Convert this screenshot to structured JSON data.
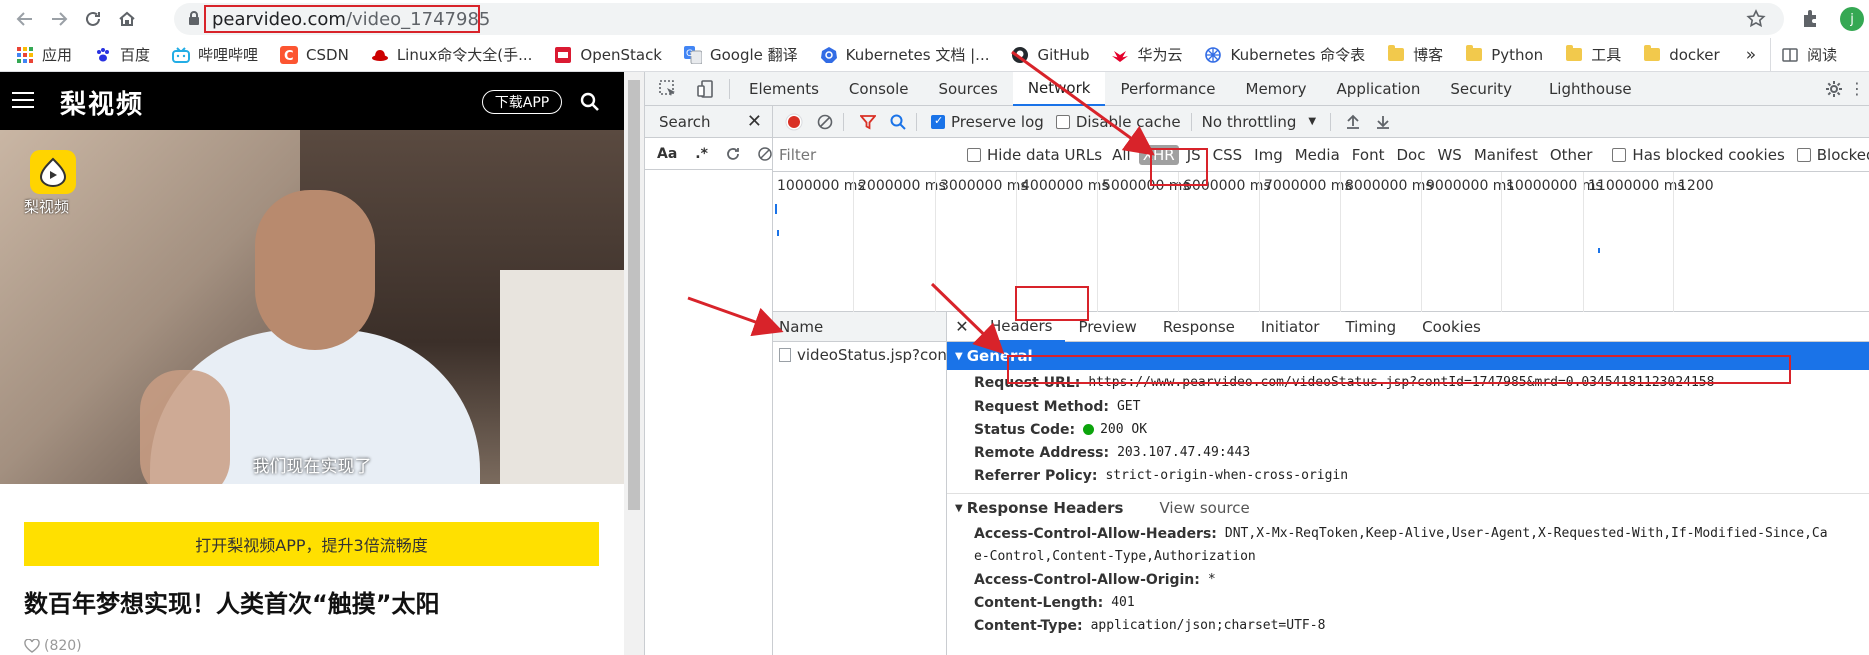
{
  "browser": {
    "url_domain": "pearvideo.com",
    "url_path": "/video_1747985",
    "avatar_letter": "j"
  },
  "bookmarks": [
    {
      "label": "应用",
      "icon": "apps-grid-icon"
    },
    {
      "label": "百度",
      "icon": "baidu-paw-icon"
    },
    {
      "label": "哔哩哔哩",
      "icon": "bilibili-tv-icon"
    },
    {
      "label": "CSDN",
      "icon": "csdn-c-icon"
    },
    {
      "label": "Linux命令大全(手...",
      "icon": "redhat-icon"
    },
    {
      "label": "OpenStack",
      "icon": "openstack-icon"
    },
    {
      "label": "Google 翻译",
      "icon": "google-translate-icon"
    },
    {
      "label": "Kubernetes 文档 |...",
      "icon": "kubernetes-icon"
    },
    {
      "label": "GitHub",
      "icon": "github-icon"
    },
    {
      "label": "华为云",
      "icon": "huawei-icon"
    },
    {
      "label": "Kubernetes 命令表",
      "icon": "kubernetes-icon"
    },
    {
      "label": "博客",
      "icon": "folder-icon"
    },
    {
      "label": "Python",
      "icon": "folder-icon"
    },
    {
      "label": "工具",
      "icon": "folder-icon"
    },
    {
      "label": "docker",
      "icon": "folder-icon"
    }
  ],
  "bookmarks_more": "»",
  "reading_list": "阅读",
  "page": {
    "logo": "梨视频",
    "download_button": "下载APP",
    "video_logo_text": "梨视频",
    "subtitle": "我们现在实现了",
    "open_app_bar": "打开梨视频APP，提升3倍流畅度",
    "headline": "数百年梦想实现！人类首次“触摸”太阳",
    "likes": "(820)"
  },
  "devtools": {
    "tabs": [
      "Elements",
      "Console",
      "Sources",
      "Network",
      "Performance",
      "Memory",
      "Application",
      "Security",
      "Lighthouse"
    ],
    "active_tab": "Network",
    "search_label": "Search",
    "search_tools": [
      "Aa",
      ".*"
    ],
    "preserve_log": "Preserve log",
    "disable_cache": "Disable cache",
    "throttling": "No throttling",
    "filter_placeholder": "Filter",
    "hide_data_urls": "Hide data URLs",
    "filter_types": [
      "All",
      "XHR",
      "JS",
      "CSS",
      "Img",
      "Media",
      "Font",
      "Doc",
      "WS",
      "Manifest",
      "Other"
    ],
    "active_filter": "XHR",
    "has_blocked_cookies": "Has blocked cookies",
    "blocked_requests": "Blocked Re",
    "timeline_ticks": [
      "1000000 ms",
      "2000000 ms",
      "3000000 ms",
      "4000000 ms",
      "5000000 ms",
      "6000000 ms",
      "7000000 ms",
      "8000000 ms",
      "9000000 ms",
      "10000000 ms",
      "11000000 ms",
      "1200"
    ],
    "name_header": "Name",
    "request_name": "videoStatus.jsp?contId=...",
    "detail_tabs": [
      "Headers",
      "Preview",
      "Response",
      "Initiator",
      "Timing",
      "Cookies"
    ],
    "active_detail_tab": "Headers",
    "general": {
      "title": "General",
      "request_url_label": "Request URL:",
      "request_url": "https://www.pearvideo.com/videoStatus.jsp?contId=1747985&mrd=0.03454181123024158",
      "request_method_label": "Request Method:",
      "request_method": "GET",
      "status_code_label": "Status Code:",
      "status_code": "200 OK",
      "remote_address_label": "Remote Address:",
      "remote_address": "203.107.47.49:443",
      "referrer_policy_label": "Referrer Policy:",
      "referrer_policy": "strict-origin-when-cross-origin"
    },
    "response_headers": {
      "title": "Response Headers",
      "view_source": "View source",
      "acah_label": "Access-Control-Allow-Headers:",
      "acah_value_1": "DNT,X-Mx-ReqToken,Keep-Alive,User-Agent,X-Requested-With,If-Modified-Since,Ca",
      "acah_value_2": "e-Control,Content-Type,Authorization",
      "acao_label": "Access-Control-Allow-Origin:",
      "acao_value": "*",
      "content_length_label": "Content-Length:",
      "content_length": "401",
      "content_type_label": "Content-Type:",
      "content_type": "application/json;charset=UTF-8"
    }
  },
  "colors": {
    "annotation_red": "#d8232a",
    "devtools_blue": "#1a73e8",
    "pear_yellow": "#ffe000"
  }
}
